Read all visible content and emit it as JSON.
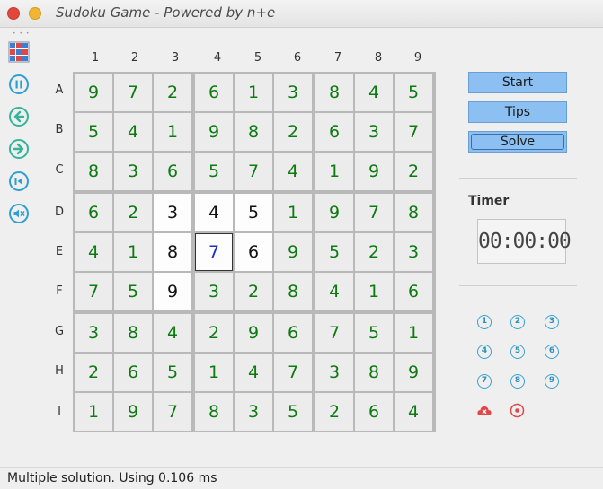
{
  "window": {
    "title": "Sudoku Game - Powered by n+e"
  },
  "board": {
    "col_headers": [
      "1",
      "2",
      "3",
      "4",
      "5",
      "6",
      "7",
      "8",
      "9"
    ],
    "row_headers": [
      "A",
      "B",
      "C",
      "D",
      "E",
      "F",
      "G",
      "H",
      "I"
    ],
    "cells": [
      [
        "9",
        "7",
        "2",
        "6",
        "1",
        "3",
        "8",
        "4",
        "5"
      ],
      [
        "5",
        "4",
        "1",
        "9",
        "8",
        "2",
        "6",
        "3",
        "7"
      ],
      [
        "8",
        "3",
        "6",
        "5",
        "7",
        "4",
        "1",
        "9",
        "2"
      ],
      [
        "6",
        "2",
        "3",
        "4",
        "5",
        "1",
        "9",
        "7",
        "8"
      ],
      [
        "4",
        "1",
        "8",
        "7",
        "6",
        "9",
        "5",
        "2",
        "3"
      ],
      [
        "7",
        "5",
        "9",
        "3",
        "2",
        "8",
        "4",
        "1",
        "6"
      ],
      [
        "3",
        "8",
        "4",
        "2",
        "9",
        "6",
        "7",
        "5",
        "1"
      ],
      [
        "2",
        "6",
        "5",
        "1",
        "4",
        "7",
        "3",
        "8",
        "9"
      ],
      [
        "1",
        "9",
        "7",
        "8",
        "3",
        "5",
        "2",
        "6",
        "4"
      ]
    ],
    "given_cells": [
      "D3",
      "D4",
      "D5",
      "E3",
      "E5",
      "F3"
    ],
    "selected_cell": "E4",
    "colors": {
      "solved_digit": "#0d7a10",
      "given_digit": "#111111",
      "selected_digit": "#1a2fbd"
    }
  },
  "toolbar": {
    "icons": [
      "grid-app-icon",
      "pause-icon",
      "undo-icon",
      "redo-icon",
      "skip-back-icon",
      "mute-icon"
    ]
  },
  "controls": {
    "start_label": "Start",
    "tips_label": "Tips",
    "solve_label": "Solve"
  },
  "timer": {
    "label": "Timer",
    "value": "00:00:00"
  },
  "numpad": {
    "digits": [
      "1",
      "2",
      "3",
      "4",
      "5",
      "6",
      "7",
      "8",
      "9"
    ],
    "extra_icons": [
      "erase-icon",
      "mark-icon"
    ]
  },
  "status": {
    "text": "Multiple solution. Using 0.106 ms"
  }
}
